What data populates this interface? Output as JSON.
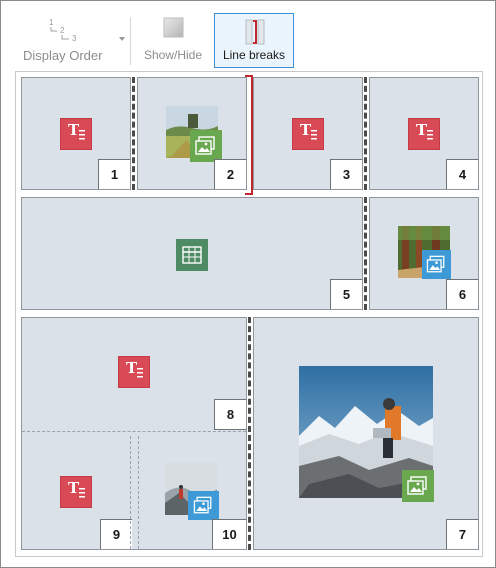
{
  "toolbar": {
    "display_order_label": "Display Order",
    "show_hide_label": "Show/Hide",
    "line_breaks_label": "Line breaks"
  },
  "cells": [
    {
      "number": "1",
      "content": "text"
    },
    {
      "number": "2",
      "content": "image"
    },
    {
      "number": "3",
      "content": "text"
    },
    {
      "number": "4",
      "content": "text"
    },
    {
      "number": "5",
      "content": "table"
    },
    {
      "number": "6",
      "content": "image"
    },
    {
      "number": "7",
      "content": "image"
    },
    {
      "number": "8",
      "content": "text"
    },
    {
      "number": "9",
      "content": "text"
    },
    {
      "number": "10",
      "content": "image"
    }
  ],
  "colors": {
    "text_icon": "#d84b56",
    "table_icon": "#4e8a63",
    "image_badge_green": "#6aa84f",
    "image_badge_blue": "#3e9ad6",
    "cell_bg": "#dbe1e8",
    "selected_button_border": "#3c8fd8",
    "line_break_red": "#c4262e"
  }
}
